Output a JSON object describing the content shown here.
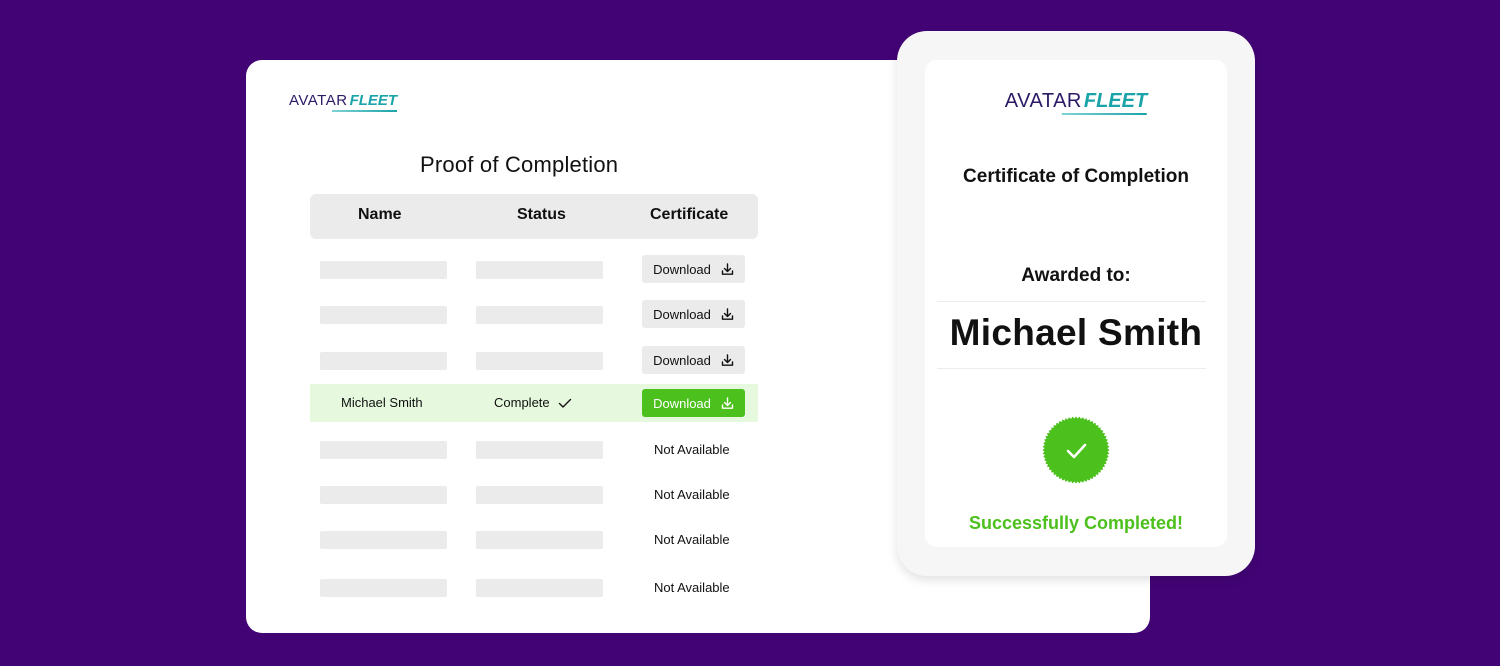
{
  "brand": {
    "part1": "AVATAR",
    "part2": "FLEET"
  },
  "colors": {
    "background": "#420475",
    "accent_green": "#4cc01c",
    "highlight_row": "#e6f8de",
    "logo_teal": "#1aa3a8",
    "logo_navy": "#2c1a66"
  },
  "proof": {
    "title": "Proof of Completion",
    "columns": [
      "Name",
      "Status",
      "Certificate"
    ],
    "rows": [
      {
        "name": "",
        "status": "",
        "certificate": "Download",
        "placeholder": true
      },
      {
        "name": "",
        "status": "",
        "certificate": "Download",
        "placeholder": true
      },
      {
        "name": "",
        "status": "",
        "certificate": "Download",
        "placeholder": true
      },
      {
        "name": "Michael Smith",
        "status": "Complete",
        "certificate": "Download",
        "placeholder": false,
        "highlighted": true
      },
      {
        "name": "",
        "status": "",
        "certificate": "Not Available",
        "placeholder": true
      },
      {
        "name": "",
        "status": "",
        "certificate": "Not Available",
        "placeholder": true
      },
      {
        "name": "",
        "status": "",
        "certificate": "Not Available",
        "placeholder": true
      },
      {
        "name": "",
        "status": "",
        "certificate": "Not Available",
        "placeholder": true
      }
    ]
  },
  "certificate": {
    "title": "Certificate of Completion",
    "awarded_label": "Awarded to:",
    "recipient": "Michael Smith",
    "seal_icon": "check-seal-icon",
    "status_text": "Successfully Completed!"
  }
}
